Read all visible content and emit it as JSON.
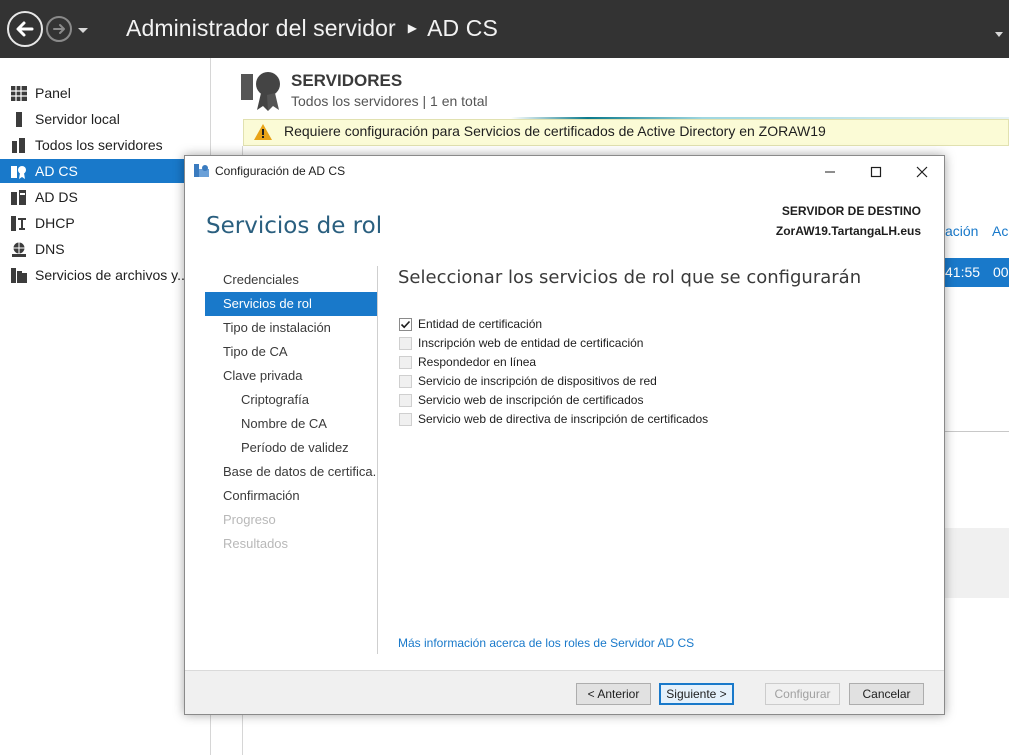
{
  "window": {
    "title": "Administrador del servidor",
    "breadcrumb_current": "AD CS"
  },
  "sidebar": {
    "items": [
      {
        "label": "Panel",
        "icon": "dashboard-icon"
      },
      {
        "label": "Servidor local",
        "icon": "local-server-icon"
      },
      {
        "label": "Todos los servidores",
        "icon": "all-servers-icon"
      },
      {
        "label": "AD CS",
        "icon": "adcs-icon",
        "selected": true
      },
      {
        "label": "AD DS",
        "icon": "adds-icon"
      },
      {
        "label": "DHCP",
        "icon": "dhcp-icon"
      },
      {
        "label": "DNS",
        "icon": "dns-icon"
      },
      {
        "label": "Servicios de archivos y...",
        "icon": "file-services-icon"
      }
    ]
  },
  "servers_tile": {
    "title": "SERVIDORES",
    "subtitle": "Todos los servidores | 1 en total",
    "warning": "Requiere configuración para Servicios de certificados de Active Directory en ZORAW19",
    "partial_columns": [
      "ación",
      "Ac"
    ],
    "partial_row": [
      "41:55",
      "00"
    ]
  },
  "dialog": {
    "title": "Configuración de AD CS",
    "heading": "Servicios de rol",
    "destination_label": "SERVIDOR DE DESTINO",
    "destination_value": "ZorAW19.TartangaLH.eus",
    "steps": [
      {
        "label": "Credenciales",
        "state": "normal",
        "level": 0
      },
      {
        "label": "Servicios de rol",
        "state": "current",
        "level": 0
      },
      {
        "label": "Tipo de instalación",
        "state": "normal",
        "level": 0
      },
      {
        "label": "Tipo de CA",
        "state": "normal",
        "level": 0
      },
      {
        "label": "Clave privada",
        "state": "normal",
        "level": 0
      },
      {
        "label": "Criptografía",
        "state": "normal",
        "level": 1
      },
      {
        "label": "Nombre de CA",
        "state": "normal",
        "level": 1
      },
      {
        "label": "Período de validez",
        "state": "normal",
        "level": 1
      },
      {
        "label": "Base de datos de certifica...",
        "state": "normal",
        "level": 0
      },
      {
        "label": "Confirmación",
        "state": "normal",
        "level": 0
      },
      {
        "label": "Progreso",
        "state": "disabled",
        "level": 0
      },
      {
        "label": "Resultados",
        "state": "disabled",
        "level": 0
      }
    ],
    "main_title": "Seleccionar los servicios de rol que se configurarán",
    "role_services": [
      {
        "label": "Entidad de certificación",
        "checked": true,
        "enabled": true
      },
      {
        "label": "Inscripción web de entidad de certificación",
        "checked": false,
        "enabled": false
      },
      {
        "label": "Respondedor en línea",
        "checked": false,
        "enabled": false
      },
      {
        "label": "Servicio de inscripción de dispositivos de red",
        "checked": false,
        "enabled": false
      },
      {
        "label": "Servicio web de inscripción de certificados",
        "checked": false,
        "enabled": false
      },
      {
        "label": "Servicio web de directiva de inscripción de certificados",
        "checked": false,
        "enabled": false
      }
    ],
    "more_info_link": "Más información acerca de los roles de Servidor AD CS",
    "buttons": {
      "previous": "< Anterior",
      "next": "Siguiente >",
      "configure": "Configurar",
      "cancel": "Cancelar"
    }
  },
  "colors": {
    "accent": "#1979ca",
    "titlebar": "#333333",
    "heading": "#2a5f7f",
    "warning_bg": "#fbfbd6"
  }
}
